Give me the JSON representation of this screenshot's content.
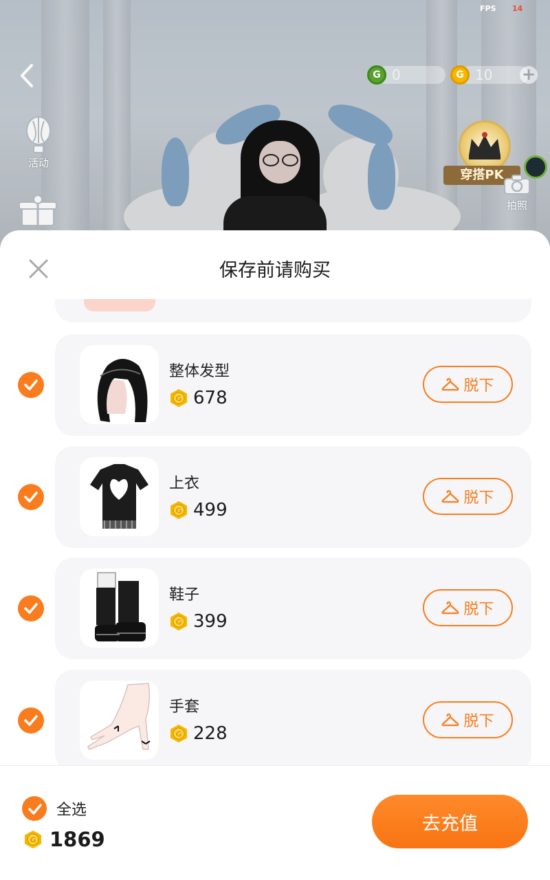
{
  "status": {
    "fps_label": "FPS",
    "fps_value": "14"
  },
  "scene": {
    "currencies": [
      {
        "icon": "green-g-coin-icon",
        "value": "0",
        "color": "#5aa12e"
      },
      {
        "icon": "gold-g-coin-icon",
        "value": "10",
        "color": "#f5b800"
      }
    ],
    "activity_label": "活动",
    "pk_label": "穿搭PK",
    "photo_label": "拍照"
  },
  "sheet": {
    "title": "保存前请购买",
    "items": [
      {
        "name": "整体发型",
        "price": "678",
        "remove_label": "脱下",
        "checked": true,
        "thumb": "hairstyle-thumbnail"
      },
      {
        "name": "上衣",
        "price": "499",
        "remove_label": "脱下",
        "checked": true,
        "thumb": "top-shirt-thumbnail"
      },
      {
        "name": "鞋子",
        "price": "399",
        "remove_label": "脱下",
        "checked": true,
        "thumb": "shoes-thumbnail"
      },
      {
        "name": "手套",
        "price": "228",
        "remove_label": "脱下",
        "checked": true,
        "thumb": "gloves-thumbnail"
      }
    ],
    "footer": {
      "select_all_label": "全选",
      "total": "1869",
      "recharge_label": "去充值"
    }
  },
  "colors": {
    "accent": "#f97c1e",
    "card_bg": "#f6f6f8",
    "coin": "#f5b800"
  }
}
